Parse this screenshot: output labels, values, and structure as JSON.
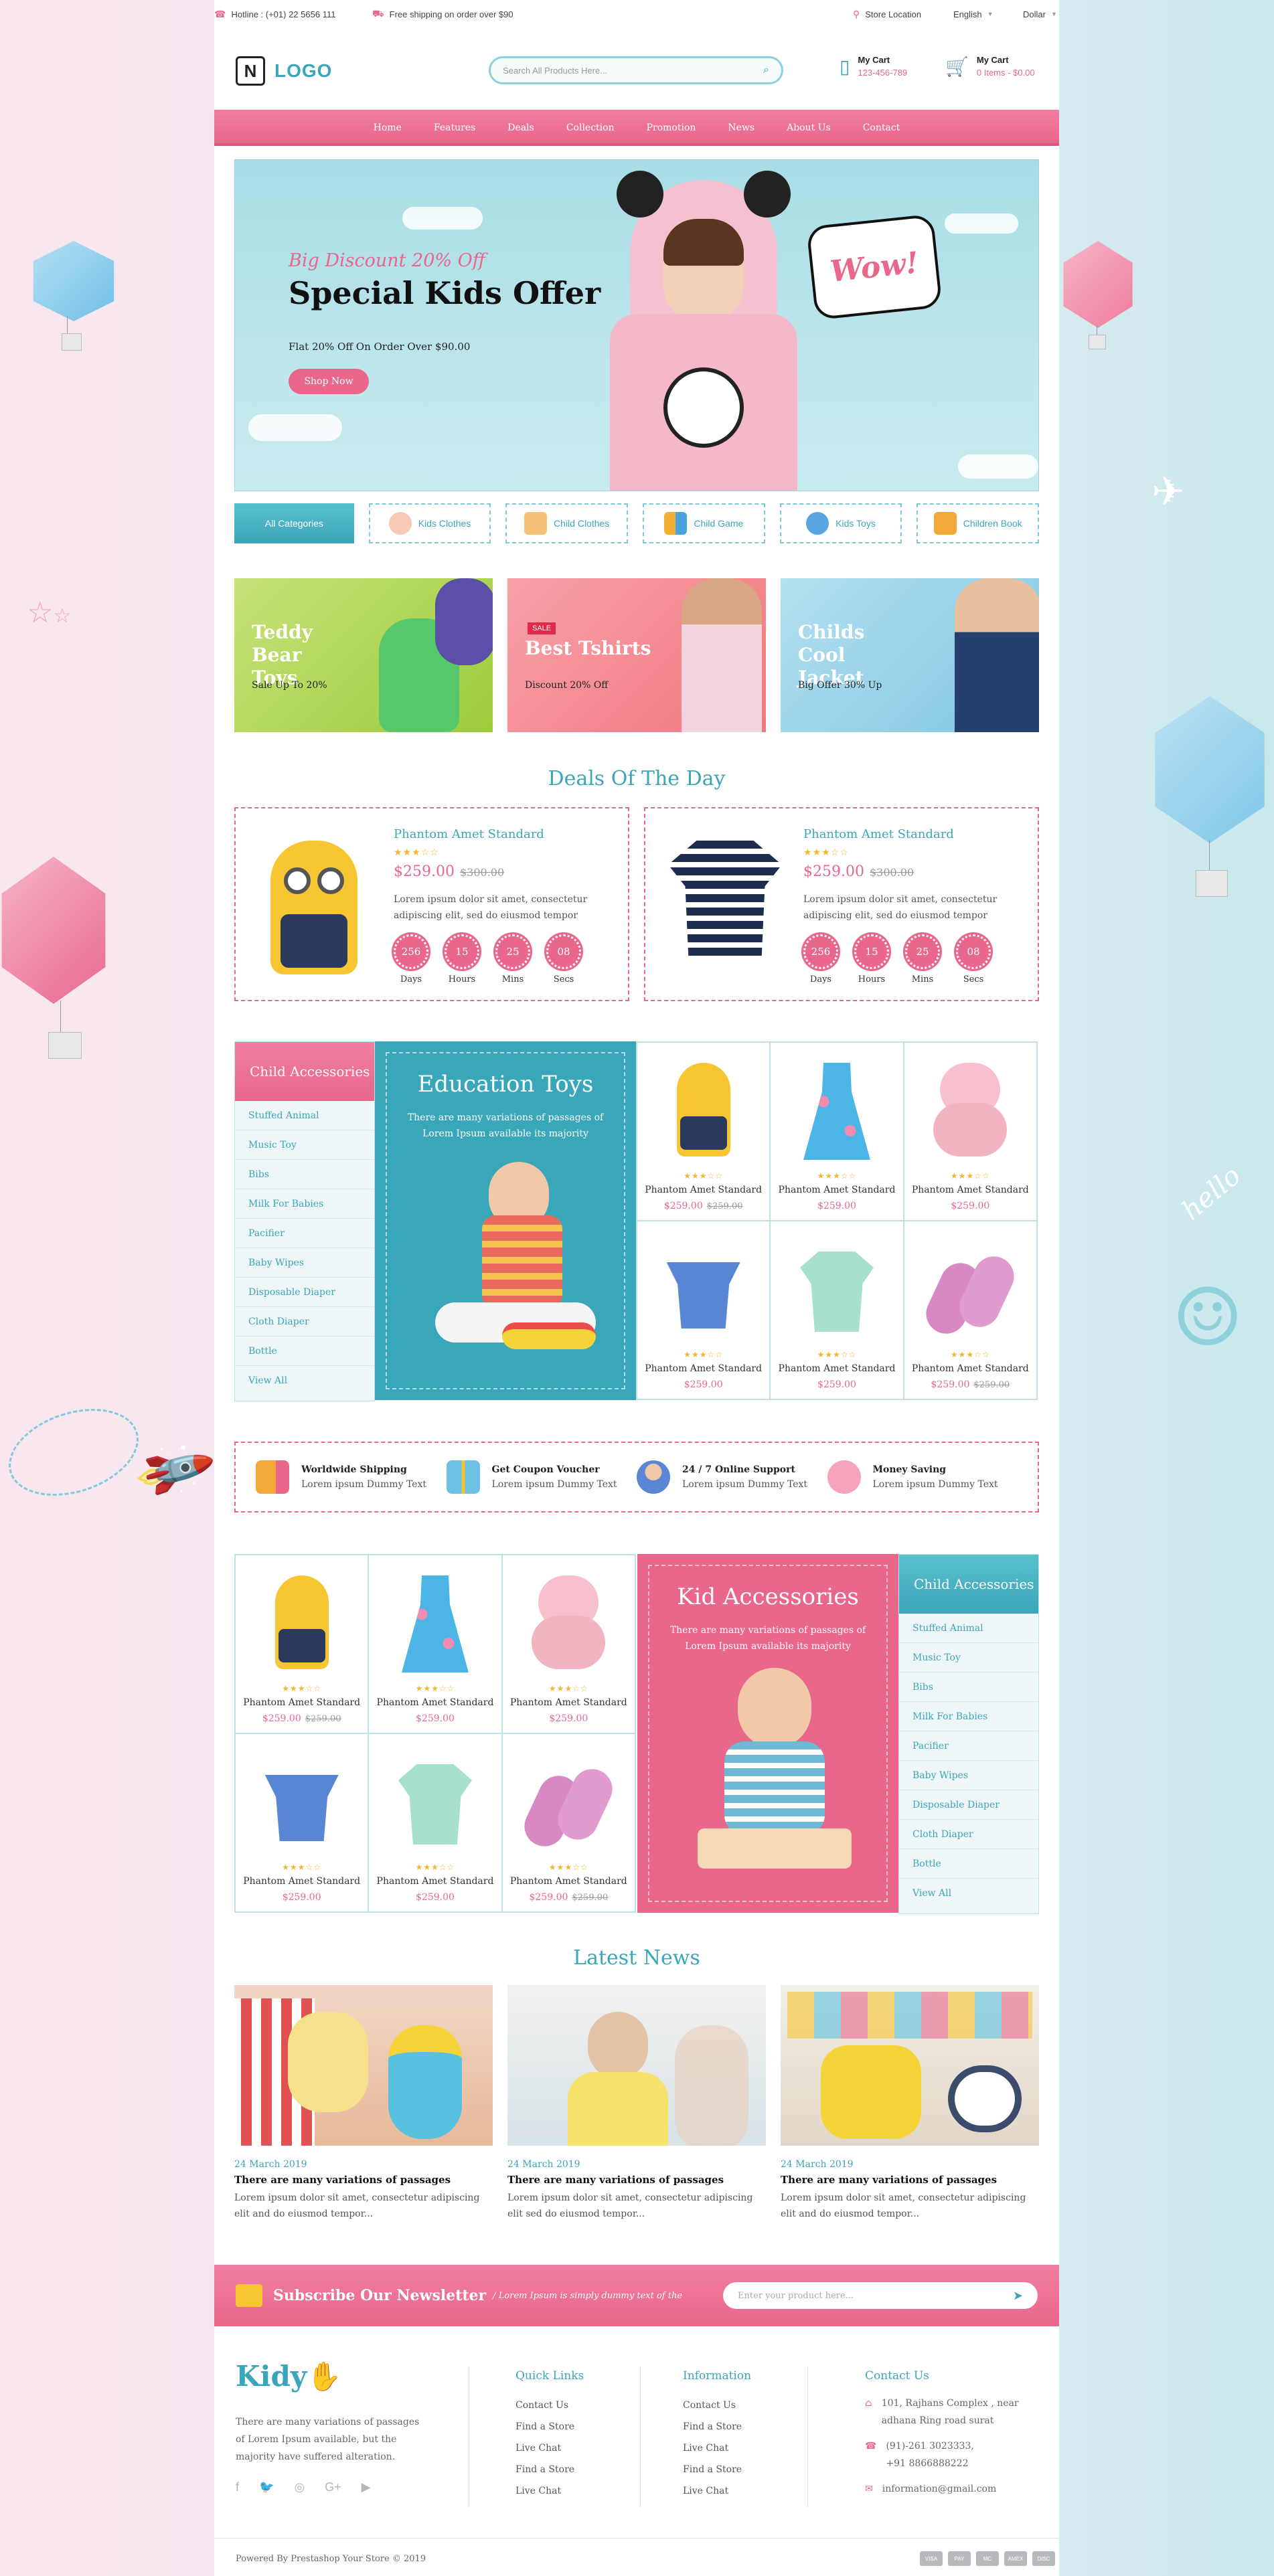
{
  "topbar": {
    "hotline": "Hotline : (+01) 22 5656 111",
    "shipping": "Free shipping on order over $90",
    "store_location": "Store Location",
    "language": "English",
    "currency": "Dollar"
  },
  "header": {
    "logo_text": "LOGO",
    "logo_letter": "N",
    "search_placeholder": "Search All Products Here...",
    "phone_label": "My Cart",
    "phone_value": "123-456-789",
    "cart_label": "My Cart",
    "cart_value": "0 Items - $0.00"
  },
  "nav": [
    "Home",
    "Features",
    "Deals",
    "Collection",
    "Promotion",
    "News",
    "About Us",
    "Contact"
  ],
  "hero": {
    "subtitle": "Big Discount 20% Off",
    "title": "Special Kids Offer",
    "text": "Flat 20% Off On Order Over $90.00",
    "button": "Shop Now",
    "bubble": "Wow!"
  },
  "categories": [
    "All Categories",
    "Kids Clothes",
    "Child Clothes",
    "Child Game",
    "Kids Toys",
    "Children Book"
  ],
  "banners": [
    {
      "title": "Teddy Bear Toys",
      "sub": "Sale Up To 20%",
      "tag": ""
    },
    {
      "title": "Best Tshirts",
      "sub": "Discount 20% Off",
      "tag": "SALE"
    },
    {
      "title": "Childs Cool Jacket",
      "sub": "Big Offer 30% Up",
      "tag": ""
    }
  ],
  "deals": {
    "title": "Deals Of The Day",
    "items": [
      {
        "name": "Phantom Amet Standard",
        "price": "$259.00",
        "old": "$300.00",
        "desc": "Lorem ipsum dolor sit amet, consectetur adipiscing elit, sed do eiusmod tempor",
        "timer": [
          {
            "v": "256",
            "l": "Days"
          },
          {
            "v": "15",
            "l": "Hours"
          },
          {
            "v": "25",
            "l": "Mins"
          },
          {
            "v": "08",
            "l": "Secs"
          }
        ]
      },
      {
        "name": "Phantom Amet Standard",
        "price": "$259.00",
        "old": "$300.00",
        "desc": "Lorem ipsum dolor sit amet, consectetur adipiscing elit, sed do eiusmod tempor",
        "timer": [
          {
            "v": "256",
            "l": "Days"
          },
          {
            "v": "15",
            "l": "Hours"
          },
          {
            "v": "25",
            "l": "Mins"
          },
          {
            "v": "08",
            "l": "Secs"
          }
        ]
      }
    ]
  },
  "accessories_panel_1": {
    "title": "Child Accessories",
    "items": [
      "Stuffed Animal",
      "Music Toy",
      "Bibs",
      "Milk For Babies",
      "Pacifier",
      "Baby Wipes",
      "Disposable Diaper",
      "Cloth Diaper",
      "Bottle",
      "View All"
    ]
  },
  "promo_1": {
    "title": "Education Toys",
    "desc": "There are many variations of passages of Lorem Ipsum available its majority"
  },
  "grid_1": [
    {
      "name": "Phantom Amet Standard",
      "price": "$259.00",
      "old": "$259.00"
    },
    {
      "name": "Phantom Amet Standard",
      "price": "$259.00",
      "old": ""
    },
    {
      "name": "Phantom Amet Standard",
      "price": "$259.00",
      "old": ""
    },
    {
      "name": "Phantom Amet Standard",
      "price": "$259.00",
      "old": ""
    },
    {
      "name": "Phantom Amet Standard",
      "price": "$259.00",
      "old": ""
    },
    {
      "name": "Phantom Amet Standard",
      "price": "$259.00",
      "old": "$259.00"
    }
  ],
  "features": [
    {
      "t": "Worldwide Shipping",
      "d": "Lorem ipsum Dummy Text"
    },
    {
      "t": "Get Coupon Voucher",
      "d": "Lorem ipsum Dummy Text"
    },
    {
      "t": "24 / 7 Online Support",
      "d": "Lorem ipsum Dummy Text"
    },
    {
      "t": "Money Saving",
      "d": "Lorem ipsum Dummy Text"
    }
  ],
  "grid_2": [
    {
      "name": "Phantom Amet Standard",
      "price": "$259.00",
      "old": "$259.00"
    },
    {
      "name": "Phantom Amet Standard",
      "price": "$259.00",
      "old": ""
    },
    {
      "name": "Phantom Amet Standard",
      "price": "$259.00",
      "old": ""
    },
    {
      "name": "Phantom Amet Standard",
      "price": "$259.00",
      "old": ""
    },
    {
      "name": "Phantom Amet Standard",
      "price": "$259.00",
      "old": ""
    },
    {
      "name": "Phantom Amet Standard",
      "price": "$259.00",
      "old": "$259.00"
    }
  ],
  "promo_2": {
    "title": "Kid Accessories",
    "desc": "There are many variations of passages of Lorem Ipsum available its majority"
  },
  "accessories_panel_2": {
    "title": "Child Accessories",
    "items": [
      "Stuffed Animal",
      "Music Toy",
      "Bibs",
      "Milk For Babies",
      "Pacifier",
      "Baby Wipes",
      "Disposable Diaper",
      "Cloth Diaper",
      "Bottle",
      "View All"
    ]
  },
  "news": {
    "title": "Latest News",
    "items": [
      {
        "date": "24 March 2019",
        "title": "There are many variations of passages",
        "desc": "Lorem ipsum dolor sit amet, consectetur adipiscing elit and do eiusmod tempor..."
      },
      {
        "date": "24 March 2019",
        "title": "There are many variations of passages",
        "desc": "Lorem ipsum dolor sit amet, consectetur adipiscing elit sed do eiusmod tempor..."
      },
      {
        "date": "24 March 2019",
        "title": "There are many variations of passages",
        "desc": "Lorem ipsum dolor sit amet, consectetur adipiscing elit and do eiusmod tempor..."
      }
    ]
  },
  "newsletter": {
    "title": "Subscribe Our Newsletter",
    "sub": "/ Lorem Ipsum is simply dummy text of the",
    "placeholder": "Enter your product here..."
  },
  "footer": {
    "brand": "Kidy",
    "about": "There are many variations of passages of Lorem Ipsum available, but the majority have suffered alteration.",
    "quick_links_title": "Quick Links",
    "quick_links": [
      "Contact Us",
      "Find a Store",
      "Live Chat",
      "Find a Store",
      "Live Chat"
    ],
    "info_title": "Information",
    "info_links": [
      "Contact Us",
      "Find a Store",
      "Live Chat",
      "Find a Store",
      "Live Chat"
    ],
    "contact_title": "Contact Us",
    "address": "101, Rajhans Complex , near adhana Ring road surat",
    "phone": "(91)-261 3023333,",
    "phone2": "+91 8866888222",
    "email": "information@gmail.com",
    "copyright": "Powered By Prestashop Your Store © 2019",
    "payments": [
      "VISA",
      "PAY",
      "MC",
      "AMEX",
      "DISC"
    ]
  },
  "colors": {
    "teal": "#3aa6b9",
    "pink": "#e8678b",
    "star": "#f3b72f"
  }
}
